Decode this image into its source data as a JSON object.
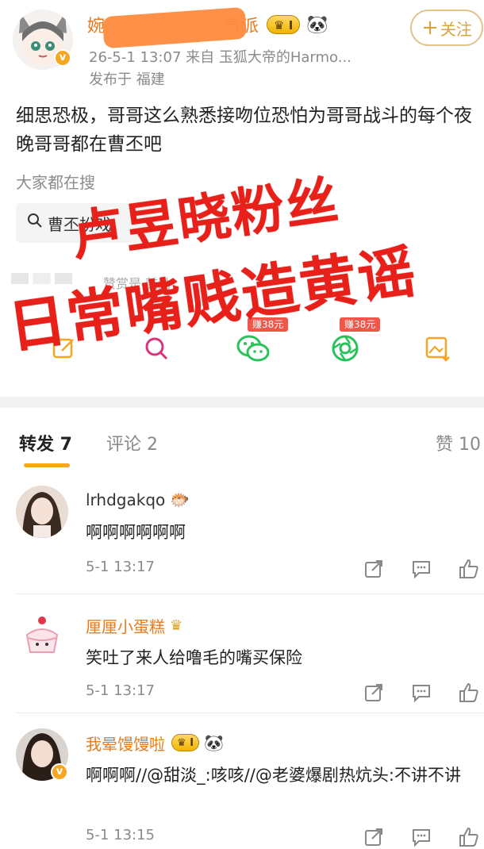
{
  "post": {
    "username_prefix": "婉",
    "username_suffix": "气派",
    "level_badge": "I",
    "follow_label": "关注",
    "meta": "26-5-1 13:07   来自 玉狐大帝的Harmo...",
    "location": "发布于 福建",
    "content": "细思恐极，哥哥这么熟悉接吻位恐怕为哥哥战斗的每个夜晚哥哥都在曹丕吧",
    "hot_label": "大家都在搜",
    "hot_search": "曹丕扮戏",
    "reward_tip": "赞赏是·鼓励",
    "share_tags": [
      "赚38元",
      "赚38元"
    ]
  },
  "watermark": {
    "line1": "卢昱晓粉丝",
    "line2": "日常嘴贱造黄谣"
  },
  "tabs": {
    "forward": "转发 7",
    "comment": "评论 2",
    "like": "赞 10"
  },
  "comments": [
    {
      "name": "lrhdgakqo",
      "text": "啊啊啊啊啊啊",
      "time": "5-1 13:17",
      "name_color": "#333333"
    },
    {
      "name": "厘厘小蛋糕",
      "text": "笑吐了来人给噜毛的嘴买保险",
      "time": "5-1 13:17",
      "name_color": "#e87a1c"
    },
    {
      "name": "我晕馒馒啦",
      "text": "啊啊啊//@甜淡_:咳咳//@老婆爆剧热炕头:不讲不讲",
      "time": "5-1 13:15",
      "name_color": "#e87a1c",
      "badge": "I"
    }
  ],
  "colors": {
    "accent": "#f5a623",
    "watermark": "#e8201a",
    "orange_name": "#e87a1c"
  }
}
